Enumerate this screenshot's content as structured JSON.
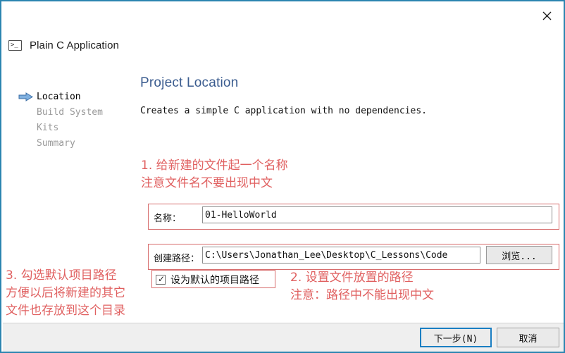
{
  "window": {
    "title": "Plain C Application",
    "app_icon": "terminal-icon",
    "close_icon": "close-icon",
    "border_color": "#2b85b0"
  },
  "sidebar": {
    "items": [
      {
        "label": "Location",
        "active": true
      },
      {
        "label": "Build System",
        "active": false
      },
      {
        "label": "Kits",
        "active": false
      },
      {
        "label": "Summary",
        "active": false
      }
    ],
    "active_arrow_icon": "arrow-right-icon",
    "active_arrow_color": "#4a86c8"
  },
  "main": {
    "heading": "Project Location",
    "heading_color": "#3b5c8f",
    "description": "Creates a simple C application with no dependencies.",
    "name_field": {
      "label": "名称：",
      "value": "01-HelloWorld"
    },
    "path_field": {
      "label": "创建路径：",
      "value": "C:\\Users\\Jonathan_Lee\\Desktop\\C_Lessons\\Code",
      "browse_label": "浏览..."
    },
    "default_path_checkbox": {
      "label": "设为默认的项目路径",
      "checked": true,
      "check_glyph": "✓"
    }
  },
  "annotations": {
    "color": "#e06060",
    "note_1_line_1": "1. 给新建的文件起一个名称",
    "note_1_line_2": "注意文件名不要出现中文",
    "note_2_line_1": "2. 设置文件放置的路径",
    "note_2_line_2": "注意：路径中不能出现中文",
    "note_3_line_1": "3. 勾选默认项目路径",
    "note_3_line_2": "方便以后将新建的其它",
    "note_3_line_3": "文件也存放到这个目录"
  },
  "footer": {
    "next_label": "下一步(N)",
    "cancel_label": "取消",
    "focus_color": "#1a7ec2"
  }
}
